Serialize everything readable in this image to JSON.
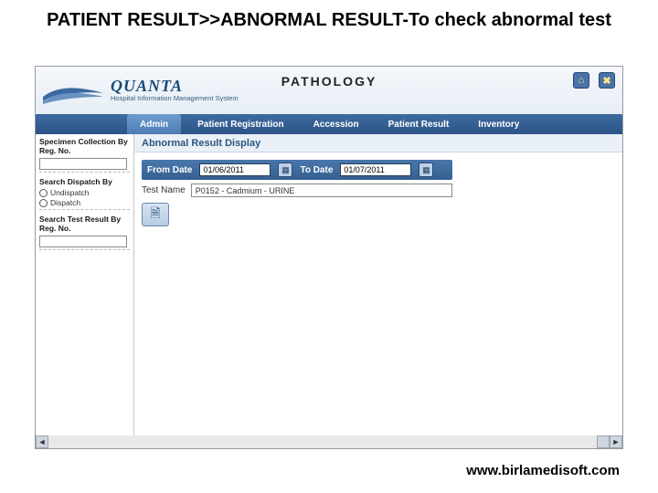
{
  "slide": {
    "title": "PATIENT RESULT>>ABNORMAL RESULT-To check abnormal test"
  },
  "brand": {
    "name": "QUANTA",
    "tagline": "Hospital Information Management System"
  },
  "module": "PATHOLOGY",
  "headerIcons": {
    "home": "⌂",
    "close": "✖"
  },
  "nav": {
    "items": [
      {
        "label": "Admin",
        "active": true
      },
      {
        "label": "Patient Registration",
        "active": false
      },
      {
        "label": "Accession",
        "active": false
      },
      {
        "label": "Patient Result",
        "active": false
      },
      {
        "label": "Inventory",
        "active": false
      }
    ]
  },
  "sidebar": {
    "group1": {
      "title": "Specimen Collection By Reg. No."
    },
    "group2": {
      "title": "Search Dispatch By",
      "opt1": "Undispatch",
      "opt2": "Dispatch"
    },
    "group3": {
      "title": "Search Test Result By Reg. No."
    }
  },
  "panel": {
    "title": "Abnormal Result Display",
    "fromLabel": "From Date",
    "toLabel": "To Date",
    "fromValue": "01/06/2011",
    "toValue": "01/07/2011",
    "testLabel": "Test Name",
    "testValue": "P0152 - Cadmium - URINE"
  },
  "footer": {
    "url": "www.birlamedisoft.com"
  },
  "icons": {
    "calendar": "▦",
    "report": "🗎",
    "left": "◄",
    "right": "►"
  }
}
